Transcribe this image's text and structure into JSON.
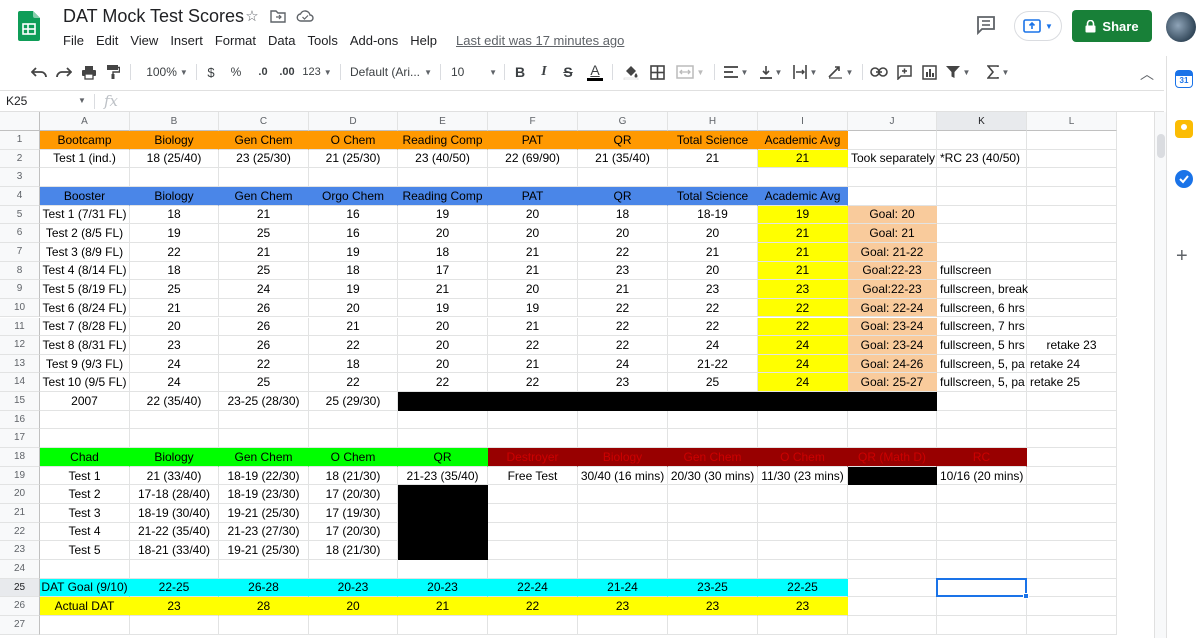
{
  "app": {
    "doc_title": "DAT Mock Test Scores",
    "menu": [
      "File",
      "Edit",
      "View",
      "Insert",
      "Format",
      "Data",
      "Tools",
      "Add-ons",
      "Help"
    ],
    "last_edit": "Last edit was 17 minutes ago",
    "share_label": "Share"
  },
  "toolbar": {
    "zoom": "100%",
    "currency": "$",
    "percent": "%",
    "decimal_less": ".0",
    "decimal_more": ".00",
    "more_formats": "123",
    "font": "Default (Ari...",
    "font_size": "10",
    "bold": "B",
    "italic": "I",
    "strike": "S",
    "text_color": "A"
  },
  "formula_bar": {
    "name_box": "K25",
    "fx": "fx"
  },
  "columns": [
    "A",
    "B",
    "C",
    "D",
    "E",
    "F",
    "G",
    "H",
    "I",
    "J",
    "K",
    "L"
  ],
  "selected": {
    "column": "K",
    "row": 25
  },
  "colors": {
    "orange": "#ff9900",
    "blue": "#4a86e8",
    "yellow": "#ffff00",
    "peach": "#f9cb9c",
    "green": "#00ff00",
    "dark_red": "#980000",
    "dark_red_text": "#cc0000",
    "cyan": "#00ffff",
    "black": "#000000",
    "share_green": "#188038",
    "selection_blue": "#1a73e8"
  },
  "rows": [
    {
      "n": 1,
      "cells": [
        {
          "c": "A",
          "v": "Bootcamp",
          "bg": "orange"
        },
        {
          "c": "B",
          "v": "Biology",
          "bg": "orange"
        },
        {
          "c": "C",
          "v": "Gen Chem",
          "bg": "orange"
        },
        {
          "c": "D",
          "v": "O Chem",
          "bg": "orange"
        },
        {
          "c": "E",
          "v": "Reading Comp",
          "bg": "orange"
        },
        {
          "c": "F",
          "v": "PAT",
          "bg": "orange"
        },
        {
          "c": "G",
          "v": "QR",
          "bg": "orange"
        },
        {
          "c": "H",
          "v": "Total Science",
          "bg": "orange"
        },
        {
          "c": "I",
          "v": "Academic Avg",
          "bg": "orange"
        }
      ]
    },
    {
      "n": 2,
      "cells": [
        {
          "c": "A",
          "v": "Test 1 (ind.)"
        },
        {
          "c": "B",
          "v": "18 (25/40)"
        },
        {
          "c": "C",
          "v": "23 (25/30)"
        },
        {
          "c": "D",
          "v": "21 (25/30)"
        },
        {
          "c": "E",
          "v": "23 (40/50)"
        },
        {
          "c": "F",
          "v": "22 (69/90)"
        },
        {
          "c": "G",
          "v": "21 (35/40)"
        },
        {
          "c": "H",
          "v": "21"
        },
        {
          "c": "I",
          "v": "21",
          "bg": "yellow"
        },
        {
          "c": "J",
          "v": "Took separately",
          "align": "l"
        },
        {
          "c": "K",
          "v": "*RC 23 (40/50)",
          "align": "l"
        }
      ]
    },
    {
      "n": 3,
      "cells": []
    },
    {
      "n": 4,
      "cells": [
        {
          "c": "A",
          "v": "Booster",
          "bg": "blue"
        },
        {
          "c": "B",
          "v": "Biology",
          "bg": "blue"
        },
        {
          "c": "C",
          "v": "Gen Chem",
          "bg": "blue"
        },
        {
          "c": "D",
          "v": "Orgo Chem",
          "bg": "blue"
        },
        {
          "c": "E",
          "v": "Reading Comp",
          "bg": "blue"
        },
        {
          "c": "F",
          "v": "PAT",
          "bg": "blue"
        },
        {
          "c": "G",
          "v": "QR",
          "bg": "blue"
        },
        {
          "c": "H",
          "v": "Total Science",
          "bg": "blue"
        },
        {
          "c": "I",
          "v": "Academic Avg",
          "bg": "blue"
        }
      ]
    },
    {
      "n": 5,
      "cells": [
        {
          "c": "A",
          "v": "Test 1 (7/31 FL)"
        },
        {
          "c": "B",
          "v": "18"
        },
        {
          "c": "C",
          "v": "21"
        },
        {
          "c": "D",
          "v": "16"
        },
        {
          "c": "E",
          "v": "19"
        },
        {
          "c": "F",
          "v": "20"
        },
        {
          "c": "G",
          "v": "18"
        },
        {
          "c": "H",
          "v": "18-19"
        },
        {
          "c": "I",
          "v": "19",
          "bg": "yellow"
        },
        {
          "c": "J",
          "v": "Goal: 20",
          "bg": "peach"
        }
      ]
    },
    {
      "n": 6,
      "cells": [
        {
          "c": "A",
          "v": "Test 2 (8/5 FL)"
        },
        {
          "c": "B",
          "v": "19"
        },
        {
          "c": "C",
          "v": "25"
        },
        {
          "c": "D",
          "v": "16"
        },
        {
          "c": "E",
          "v": "20"
        },
        {
          "c": "F",
          "v": "20"
        },
        {
          "c": "G",
          "v": "20"
        },
        {
          "c": "H",
          "v": "20"
        },
        {
          "c": "I",
          "v": "21",
          "bg": "yellow"
        },
        {
          "c": "J",
          "v": "Goal: 21",
          "bg": "peach"
        }
      ]
    },
    {
      "n": 7,
      "cells": [
        {
          "c": "A",
          "v": "Test 3 (8/9 FL)"
        },
        {
          "c": "B",
          "v": "22"
        },
        {
          "c": "C",
          "v": "21"
        },
        {
          "c": "D",
          "v": "19"
        },
        {
          "c": "E",
          "v": "18"
        },
        {
          "c": "F",
          "v": "21"
        },
        {
          "c": "G",
          "v": "22"
        },
        {
          "c": "H",
          "v": "21"
        },
        {
          "c": "I",
          "v": "21",
          "bg": "yellow"
        },
        {
          "c": "J",
          "v": "Goal: 21-22",
          "bg": "peach"
        }
      ]
    },
    {
      "n": 8,
      "cells": [
        {
          "c": "A",
          "v": "Test 4 (8/14 FL)"
        },
        {
          "c": "B",
          "v": "18"
        },
        {
          "c": "C",
          "v": "25"
        },
        {
          "c": "D",
          "v": "18"
        },
        {
          "c": "E",
          "v": "17"
        },
        {
          "c": "F",
          "v": "21"
        },
        {
          "c": "G",
          "v": "23"
        },
        {
          "c": "H",
          "v": "20"
        },
        {
          "c": "I",
          "v": "21",
          "bg": "yellow"
        },
        {
          "c": "J",
          "v": "Goal:22-23",
          "bg": "peach"
        },
        {
          "c": "K",
          "v": "fullscreen",
          "align": "l"
        }
      ]
    },
    {
      "n": 9,
      "cells": [
        {
          "c": "A",
          "v": "Test 5 (8/19 FL)"
        },
        {
          "c": "B",
          "v": "25"
        },
        {
          "c": "C",
          "v": "24"
        },
        {
          "c": "D",
          "v": "19"
        },
        {
          "c": "E",
          "v": "21"
        },
        {
          "c": "F",
          "v": "20"
        },
        {
          "c": "G",
          "v": "21"
        },
        {
          "c": "H",
          "v": "23"
        },
        {
          "c": "I",
          "v": "23",
          "bg": "yellow"
        },
        {
          "c": "J",
          "v": "Goal:22-23",
          "bg": "peach"
        },
        {
          "c": "K",
          "v": "fullscreen, break",
          "align": "l"
        }
      ]
    },
    {
      "n": 10,
      "cells": [
        {
          "c": "A",
          "v": "Test 6 (8/24 FL)"
        },
        {
          "c": "B",
          "v": "21"
        },
        {
          "c": "C",
          "v": "26"
        },
        {
          "c": "D",
          "v": "20"
        },
        {
          "c": "E",
          "v": "19"
        },
        {
          "c": "F",
          "v": "19"
        },
        {
          "c": "G",
          "v": "22"
        },
        {
          "c": "H",
          "v": "22"
        },
        {
          "c": "I",
          "v": "22",
          "bg": "yellow"
        },
        {
          "c": "J",
          "v": "Goal: 22-24",
          "bg": "peach"
        },
        {
          "c": "K",
          "v": "fullscreen, 6 hrs",
          "align": "l"
        }
      ]
    },
    {
      "n": 11,
      "cells": [
        {
          "c": "A",
          "v": "Test 7 (8/28 FL)"
        },
        {
          "c": "B",
          "v": "20"
        },
        {
          "c": "C",
          "v": "26"
        },
        {
          "c": "D",
          "v": "21"
        },
        {
          "c": "E",
          "v": "20"
        },
        {
          "c": "F",
          "v": "21"
        },
        {
          "c": "G",
          "v": "22"
        },
        {
          "c": "H",
          "v": "22"
        },
        {
          "c": "I",
          "v": "22",
          "bg": "yellow"
        },
        {
          "c": "J",
          "v": "Goal: 23-24",
          "bg": "peach"
        },
        {
          "c": "K",
          "v": "fullscreen, 7 hrs",
          "align": "l"
        }
      ]
    },
    {
      "n": 12,
      "cells": [
        {
          "c": "A",
          "v": "Test 8 (8/31 FL)"
        },
        {
          "c": "B",
          "v": "23"
        },
        {
          "c": "C",
          "v": "26"
        },
        {
          "c": "D",
          "v": "22"
        },
        {
          "c": "E",
          "v": "20"
        },
        {
          "c": "F",
          "v": "22"
        },
        {
          "c": "G",
          "v": "22"
        },
        {
          "c": "H",
          "v": "24"
        },
        {
          "c": "I",
          "v": "24",
          "bg": "yellow"
        },
        {
          "c": "J",
          "v": "Goal: 23-24",
          "bg": "peach"
        },
        {
          "c": "K",
          "v": "fullscreen, 5 hrs",
          "align": "l"
        },
        {
          "c": "L",
          "v": "retake 23"
        }
      ]
    },
    {
      "n": 13,
      "cells": [
        {
          "c": "A",
          "v": "Test 9 (9/3 FL)"
        },
        {
          "c": "B",
          "v": "24"
        },
        {
          "c": "C",
          "v": "22"
        },
        {
          "c": "D",
          "v": "18"
        },
        {
          "c": "E",
          "v": "20"
        },
        {
          "c": "F",
          "v": "21"
        },
        {
          "c": "G",
          "v": "24"
        },
        {
          "c": "H",
          "v": "21-22"
        },
        {
          "c": "I",
          "v": "24",
          "bg": "yellow"
        },
        {
          "c": "J",
          "v": "Goal: 24-26",
          "bg": "peach"
        },
        {
          "c": "K",
          "v": "fullscreen, 5, pa",
          "align": "l",
          "clip": true
        },
        {
          "c": "L",
          "v": "retake 24",
          "align": "l"
        }
      ]
    },
    {
      "n": 14,
      "cells": [
        {
          "c": "A",
          "v": "Test 10 (9/5 FL)"
        },
        {
          "c": "B",
          "v": "24"
        },
        {
          "c": "C",
          "v": "25"
        },
        {
          "c": "D",
          "v": "22"
        },
        {
          "c": "E",
          "v": "22"
        },
        {
          "c": "F",
          "v": "22"
        },
        {
          "c": "G",
          "v": "23"
        },
        {
          "c": "H",
          "v": "25"
        },
        {
          "c": "I",
          "v": "24",
          "bg": "yellow"
        },
        {
          "c": "J",
          "v": "Goal: 25-27",
          "bg": "peach"
        },
        {
          "c": "K",
          "v": "fullscreen, 5, pa",
          "align": "l",
          "clip": true
        },
        {
          "c": "L",
          "v": "retake 25",
          "align": "l"
        }
      ]
    },
    {
      "n": 15,
      "cells": [
        {
          "c": "A",
          "v": "2007"
        },
        {
          "c": "B",
          "v": "22 (35/40)"
        },
        {
          "c": "C",
          "v": "23-25 (28/30)"
        },
        {
          "c": "D",
          "v": "25 (29/30)"
        },
        {
          "c": "E",
          "v": "",
          "bg": "black"
        },
        {
          "c": "F",
          "v": "",
          "bg": "black"
        },
        {
          "c": "G",
          "v": "",
          "bg": "black"
        },
        {
          "c": "H",
          "v": "",
          "bg": "black"
        },
        {
          "c": "I",
          "v": "",
          "bg": "black"
        },
        {
          "c": "J",
          "v": "",
          "bg": "black"
        }
      ]
    },
    {
      "n": 16,
      "cells": []
    },
    {
      "n": 17,
      "cells": []
    },
    {
      "n": 18,
      "cells": [
        {
          "c": "A",
          "v": "Chad",
          "bg": "green"
        },
        {
          "c": "B",
          "v": "Biology",
          "bg": "green"
        },
        {
          "c": "C",
          "v": "Gen Chem",
          "bg": "green"
        },
        {
          "c": "D",
          "v": "O Chem",
          "bg": "green"
        },
        {
          "c": "E",
          "v": "QR",
          "bg": "green"
        },
        {
          "c": "F",
          "v": "Destroyer",
          "bg": "dark_red",
          "fg": "dark_red_text"
        },
        {
          "c": "G",
          "v": "Biology",
          "bg": "dark_red",
          "fg": "dark_red_text"
        },
        {
          "c": "H",
          "v": "Gen Chem",
          "bg": "dark_red",
          "fg": "dark_red_text"
        },
        {
          "c": "I",
          "v": "O Chem",
          "bg": "dark_red",
          "fg": "dark_red_text"
        },
        {
          "c": "J",
          "v": "QR (Math D)",
          "bg": "dark_red",
          "fg": "dark_red_text"
        },
        {
          "c": "K",
          "v": "RC",
          "bg": "dark_red",
          "fg": "dark_red_text"
        }
      ]
    },
    {
      "n": 19,
      "cells": [
        {
          "c": "A",
          "v": "Test 1"
        },
        {
          "c": "B",
          "v": "21 (33/40)"
        },
        {
          "c": "C",
          "v": "18-19 (22/30)"
        },
        {
          "c": "D",
          "v": "18 (21/30)"
        },
        {
          "c": "E",
          "v": "21-23 (35/40)"
        },
        {
          "c": "F",
          "v": "Free Test"
        },
        {
          "c": "G",
          "v": "30/40 (16 mins)"
        },
        {
          "c": "H",
          "v": "20/30 (30 mins)"
        },
        {
          "c": "I",
          "v": "11/30 (23 mins)"
        },
        {
          "c": "J",
          "v": "",
          "bg": "black"
        },
        {
          "c": "K",
          "v": "10/16 (20 mins)",
          "align": "l"
        }
      ]
    },
    {
      "n": 20,
      "cells": [
        {
          "c": "A",
          "v": "Test 2"
        },
        {
          "c": "B",
          "v": "17-18 (28/40)"
        },
        {
          "c": "C",
          "v": "18-19 (23/30)"
        },
        {
          "c": "D",
          "v": "17 (20/30)"
        },
        {
          "c": "E",
          "v": "",
          "bg": "black"
        }
      ]
    },
    {
      "n": 21,
      "cells": [
        {
          "c": "A",
          "v": "Test 3"
        },
        {
          "c": "B",
          "v": "18-19 (30/40)"
        },
        {
          "c": "C",
          "v": "19-21 (25/30)"
        },
        {
          "c": "D",
          "v": "17 (19/30)"
        },
        {
          "c": "E",
          "v": "",
          "bg": "black"
        }
      ]
    },
    {
      "n": 22,
      "cells": [
        {
          "c": "A",
          "v": "Test 4"
        },
        {
          "c": "B",
          "v": "21-22 (35/40)"
        },
        {
          "c": "C",
          "v": "21-23 (27/30)"
        },
        {
          "c": "D",
          "v": "17 (20/30)"
        },
        {
          "c": "E",
          "v": "",
          "bg": "black"
        }
      ]
    },
    {
      "n": 23,
      "cells": [
        {
          "c": "A",
          "v": "Test 5"
        },
        {
          "c": "B",
          "v": "18-21 (33/40)"
        },
        {
          "c": "C",
          "v": "19-21 (25/30)"
        },
        {
          "c": "D",
          "v": "18 (21/30)"
        },
        {
          "c": "E",
          "v": "",
          "bg": "black"
        }
      ]
    },
    {
      "n": 24,
      "cells": []
    },
    {
      "n": 25,
      "cells": [
        {
          "c": "A",
          "v": "DAT Goal (9/10)",
          "bg": "cyan"
        },
        {
          "c": "B",
          "v": "22-25",
          "bg": "cyan"
        },
        {
          "c": "C",
          "v": "26-28",
          "bg": "cyan"
        },
        {
          "c": "D",
          "v": "20-23",
          "bg": "cyan"
        },
        {
          "c": "E",
          "v": "20-23",
          "bg": "cyan"
        },
        {
          "c": "F",
          "v": "22-24",
          "bg": "cyan"
        },
        {
          "c": "G",
          "v": "21-24",
          "bg": "cyan"
        },
        {
          "c": "H",
          "v": "23-25",
          "bg": "cyan"
        },
        {
          "c": "I",
          "v": "22-25",
          "bg": "cyan"
        }
      ]
    },
    {
      "n": 26,
      "cells": [
        {
          "c": "A",
          "v": "Actual DAT",
          "bg": "yellow"
        },
        {
          "c": "B",
          "v": "23",
          "bg": "yellow"
        },
        {
          "c": "C",
          "v": "28",
          "bg": "yellow"
        },
        {
          "c": "D",
          "v": "20",
          "bg": "yellow"
        },
        {
          "c": "E",
          "v": "21",
          "bg": "yellow"
        },
        {
          "c": "F",
          "v": "22",
          "bg": "yellow"
        },
        {
          "c": "G",
          "v": "23",
          "bg": "yellow"
        },
        {
          "c": "H",
          "v": "23",
          "bg": "yellow"
        },
        {
          "c": "I",
          "v": "23",
          "bg": "yellow"
        }
      ]
    },
    {
      "n": 27,
      "cells": []
    }
  ]
}
